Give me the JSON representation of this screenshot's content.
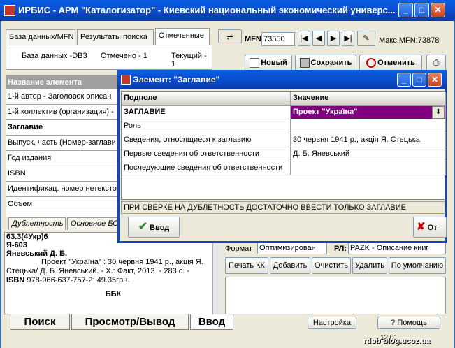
{
  "window": {
    "title": "ИРБИС - АРМ \"Каталогизатор\" - Киевский национальный экономический универс..."
  },
  "top_tabs": [
    "База данных/MFN",
    "Результаты поиска",
    "Отмеченные"
  ],
  "status": {
    "db": "База данных -DB3",
    "marked": "Отмечено - 1",
    "current": "Текущий - 1"
  },
  "mfn": {
    "label": "MFN",
    "value": "73550",
    "max": "Макс.MFN:73878"
  },
  "toolbar": {
    "new": "Новый",
    "save": "Сохранить",
    "cancel": "Отменить"
  },
  "fields_grid": {
    "header": "Название элемента",
    "rows": [
      "1-й автор - Заголовок описан",
      "1-й коллектив (организация) -",
      "Заглавие",
      "Выпуск, часть (Номер-заглави",
      "Год издания",
      "ISBN",
      "Идентификац. номер нетексто",
      "Объем"
    ]
  },
  "lower_tabs": [
    "Дублетность",
    "Основное БО"
  ],
  "record_preview": {
    "line1": "63.3(4Укр)6",
    "line2": "Я-603",
    "line3": "Яневський Д. Б.",
    "body": "Проект \"Україна\" : 30 червня 1941 р., акція Я. Стецька/ Д. Б. Яневський. - Х.: Факт, 2013. - 283 с. -",
    "isbn_label": "ISBN",
    "isbn": " 978-966-637-757-2: 49.35грн.",
    "bbk": "ББК"
  },
  "format_row": {
    "format_label": "Формат",
    "format_value": "Оптимизирован",
    "rl_label": "РЛ:",
    "rl_value": "PAZK - Описание книг"
  },
  "action_buttons": [
    "Печать КК",
    "Добавить",
    "Очистить",
    "Удалить",
    "По умолчанию"
  ],
  "bottom_tabs": [
    "Поиск",
    "Просмотр/Вывод",
    "Ввод"
  ],
  "bottom_buttons": {
    "settings": "Настройка",
    "help": "Помощь"
  },
  "clock": "12:01",
  "watermark": "rdob-blog.ucoz.ua",
  "dialog": {
    "title": "Элемент: \"Заглавие\"",
    "col_sub": "Подполе",
    "col_val": "Значение",
    "rows": [
      {
        "sub": "ЗАГЛАВИЕ",
        "val": "Проект \"Україна\""
      },
      {
        "sub": "Роль",
        "val": ""
      },
      {
        "sub": "Сведения, относящиеся к заглавию",
        "val": "30 червня 1941 р., акція Я. Стецька"
      },
      {
        "sub": "Первые сведения об ответственности",
        "val": "Д. Б. Яневський"
      },
      {
        "sub": "Последующие сведения об ответственности",
        "val": ""
      }
    ],
    "hint": "ПРИ СВЕРКЕ НА ДУБЛЕТНОСТЬ ДОСТАТОЧНО ВВЕСТИ ТОЛЬКО ЗАГЛАВИЕ",
    "ok": "Ввод",
    "cancel": "От"
  },
  "colors": {
    "title_blue": "#0b49c6",
    "selected_purple": "#800080",
    "face": "#ece9d8"
  }
}
